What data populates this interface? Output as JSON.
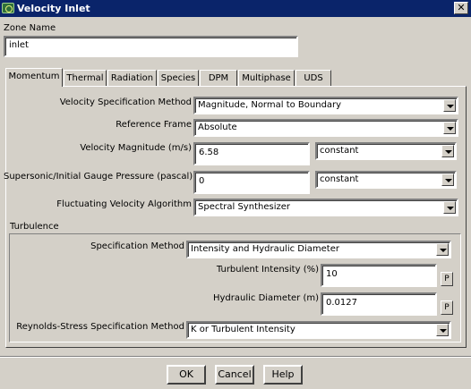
{
  "window": {
    "title": "Velocity Inlet",
    "close_glyph": "✕"
  },
  "zone": {
    "label": "Zone Name",
    "value": "inlet"
  },
  "tabs": [
    "Momentum",
    "Thermal",
    "Radiation",
    "Species",
    "DPM",
    "Multiphase",
    "UDS"
  ],
  "active_tab": "Momentum",
  "momentum": {
    "velocity_spec": {
      "label": "Velocity Specification Method",
      "value": "Magnitude, Normal to Boundary"
    },
    "reference_frame": {
      "label": "Reference Frame",
      "value": "Absolute"
    },
    "velocity_magnitude": {
      "label": "Velocity Magnitude (m/s)",
      "value": "6.58",
      "profile": "constant"
    },
    "gauge_pressure": {
      "label": "Supersonic/Initial Gauge Pressure (pascal)",
      "value": "0",
      "profile": "constant"
    },
    "fluctuating": {
      "label": "Fluctuating Velocity Algorithm",
      "value": "Spectral Synthesizer"
    }
  },
  "turbulence": {
    "group_label": "Turbulence",
    "spec_method": {
      "label": "Specification Method",
      "value": "Intensity and Hydraulic Diameter"
    },
    "intensity": {
      "label": "Turbulent Intensity (%)",
      "value": "10",
      "p_label": "P"
    },
    "diameter": {
      "label": "Hydraulic Diameter (m)",
      "value": "0.0127",
      "p_label": "P"
    },
    "reynolds": {
      "label": "Reynolds-Stress Specification Method",
      "value": "K or Turbulent Intensity"
    }
  },
  "buttons": {
    "ok": "OK",
    "cancel": "Cancel",
    "help": "Help"
  },
  "colors": {
    "titlebar": "#0a246a",
    "face": "#d4d0c8"
  }
}
